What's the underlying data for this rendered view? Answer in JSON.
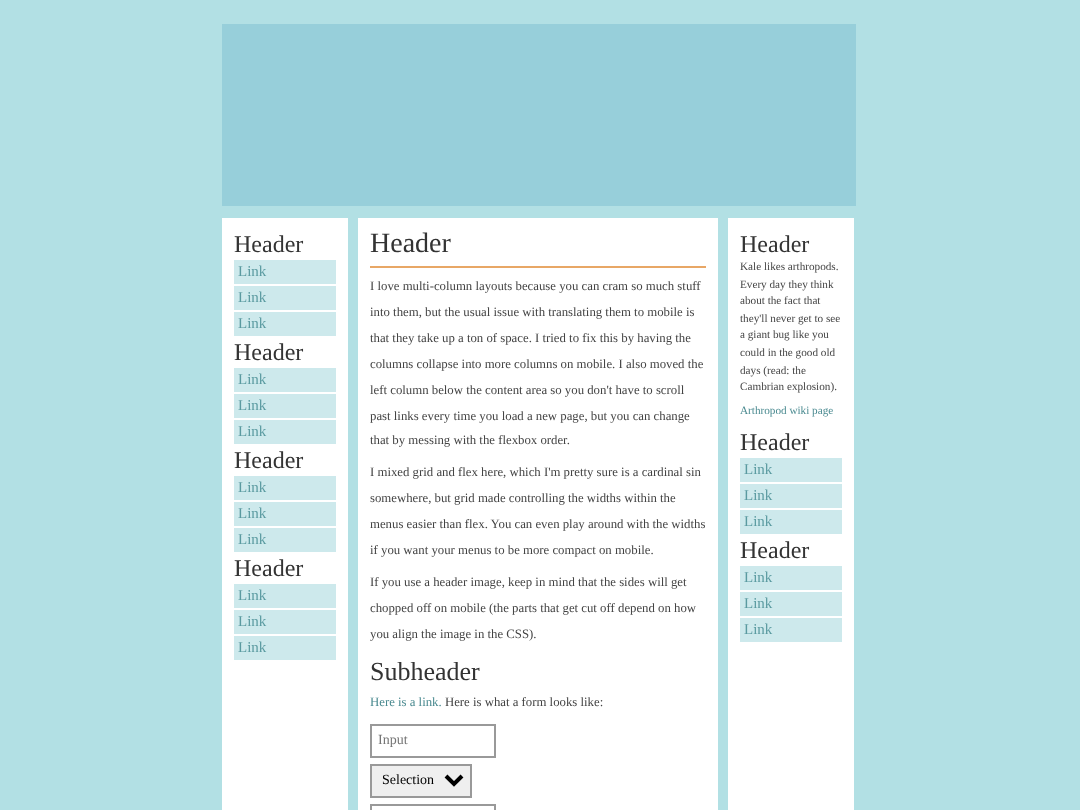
{
  "left_sections": [
    {
      "header": "Header",
      "links": [
        "Link",
        "Link",
        "Link"
      ]
    },
    {
      "header": "Header",
      "links": [
        "Link",
        "Link",
        "Link"
      ]
    },
    {
      "header": "Header",
      "links": [
        "Link",
        "Link",
        "Link"
      ]
    },
    {
      "header": "Header",
      "links": [
        "Link",
        "Link",
        "Link"
      ]
    }
  ],
  "main": {
    "header": "Header",
    "paragraphs": [
      "I love multi-column layouts because you can cram so much stuff into them, but the usual issue with translating them to mobile is that they take up a ton of space. I tried to fix this by having the columns collapse into more columns on mobile. I also moved the left column below the content area so you don't have to scroll past links every time you load a new page, but you can change that by messing with the flexbox order.",
      "I mixed grid and flex here, which I'm pretty sure is a cardinal sin somewhere, but grid made controlling the widths within the menus easier than flex. You can even play around with the widths if you want your menus to be more compact on mobile.",
      "If you use a header image, keep in mind that the sides will get chopped off on mobile (the parts that get cut off depend on how you align the image in the CSS)."
    ],
    "subheader": "Subheader",
    "link_text": "Here is a link.",
    "after_link": "Here is what a form looks like:",
    "form": {
      "input_placeholder": "Input",
      "select_value": "Selection"
    }
  },
  "right_sections": [
    {
      "header": "Header",
      "text": "Kale likes arthropods. Every day they think about the fact that they'll never get to see a giant bug like you could in the good old days (read: the Cambrian explosion).",
      "link": "Arthropod wiki page"
    },
    {
      "header": "Header",
      "links": [
        "Link",
        "Link",
        "Link"
      ]
    },
    {
      "header": "Header",
      "links": [
        "Link",
        "Link",
        "Link"
      ]
    }
  ]
}
